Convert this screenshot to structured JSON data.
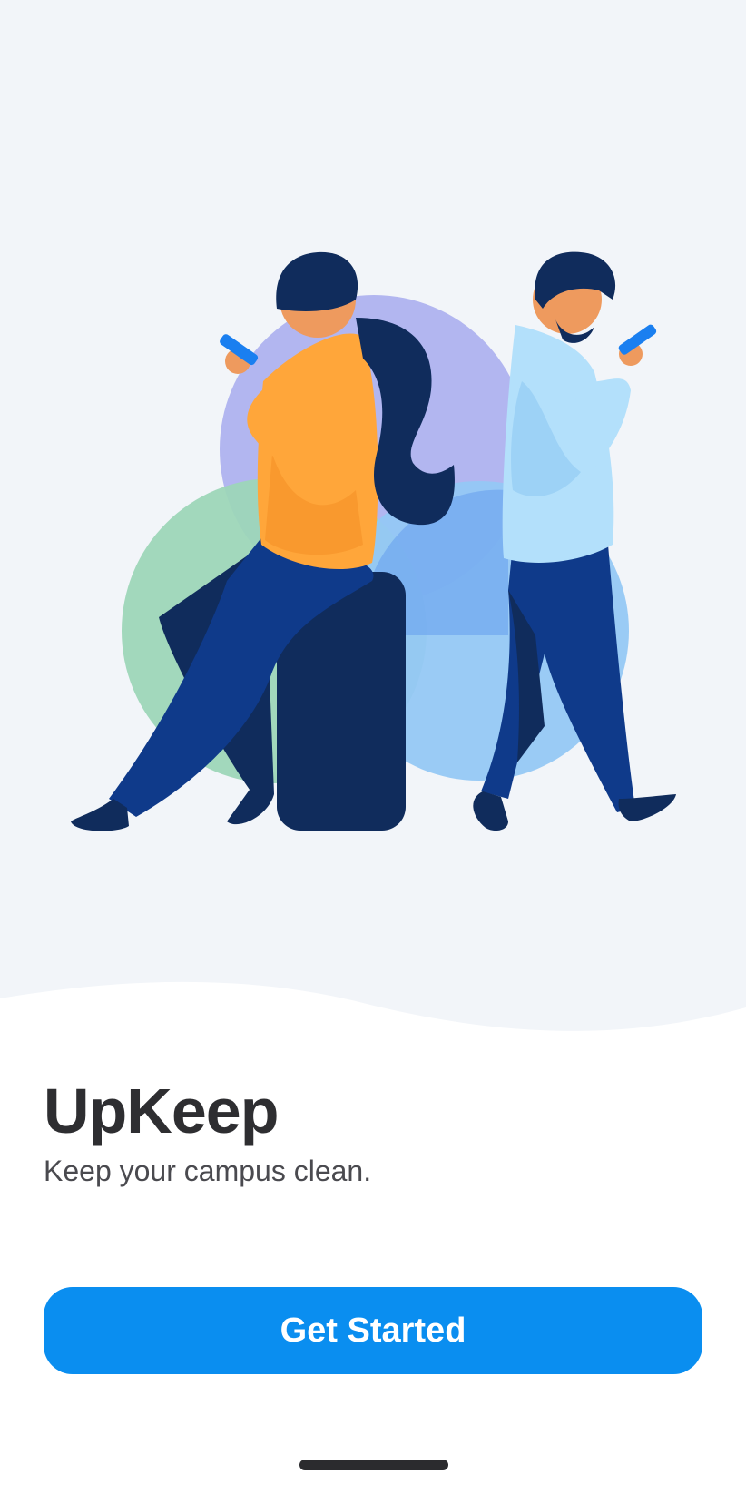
{
  "app": {
    "title": "UpKeep",
    "tagline": "Keep your campus clean."
  },
  "actions": {
    "get_started_label": "Get Started"
  },
  "colors": {
    "hero_background": "#f2f5f9",
    "primary_button": "#0a8ef0",
    "title_text": "#2e2e31"
  },
  "illustration": {
    "subject": "two-people-using-phones-illustration"
  }
}
